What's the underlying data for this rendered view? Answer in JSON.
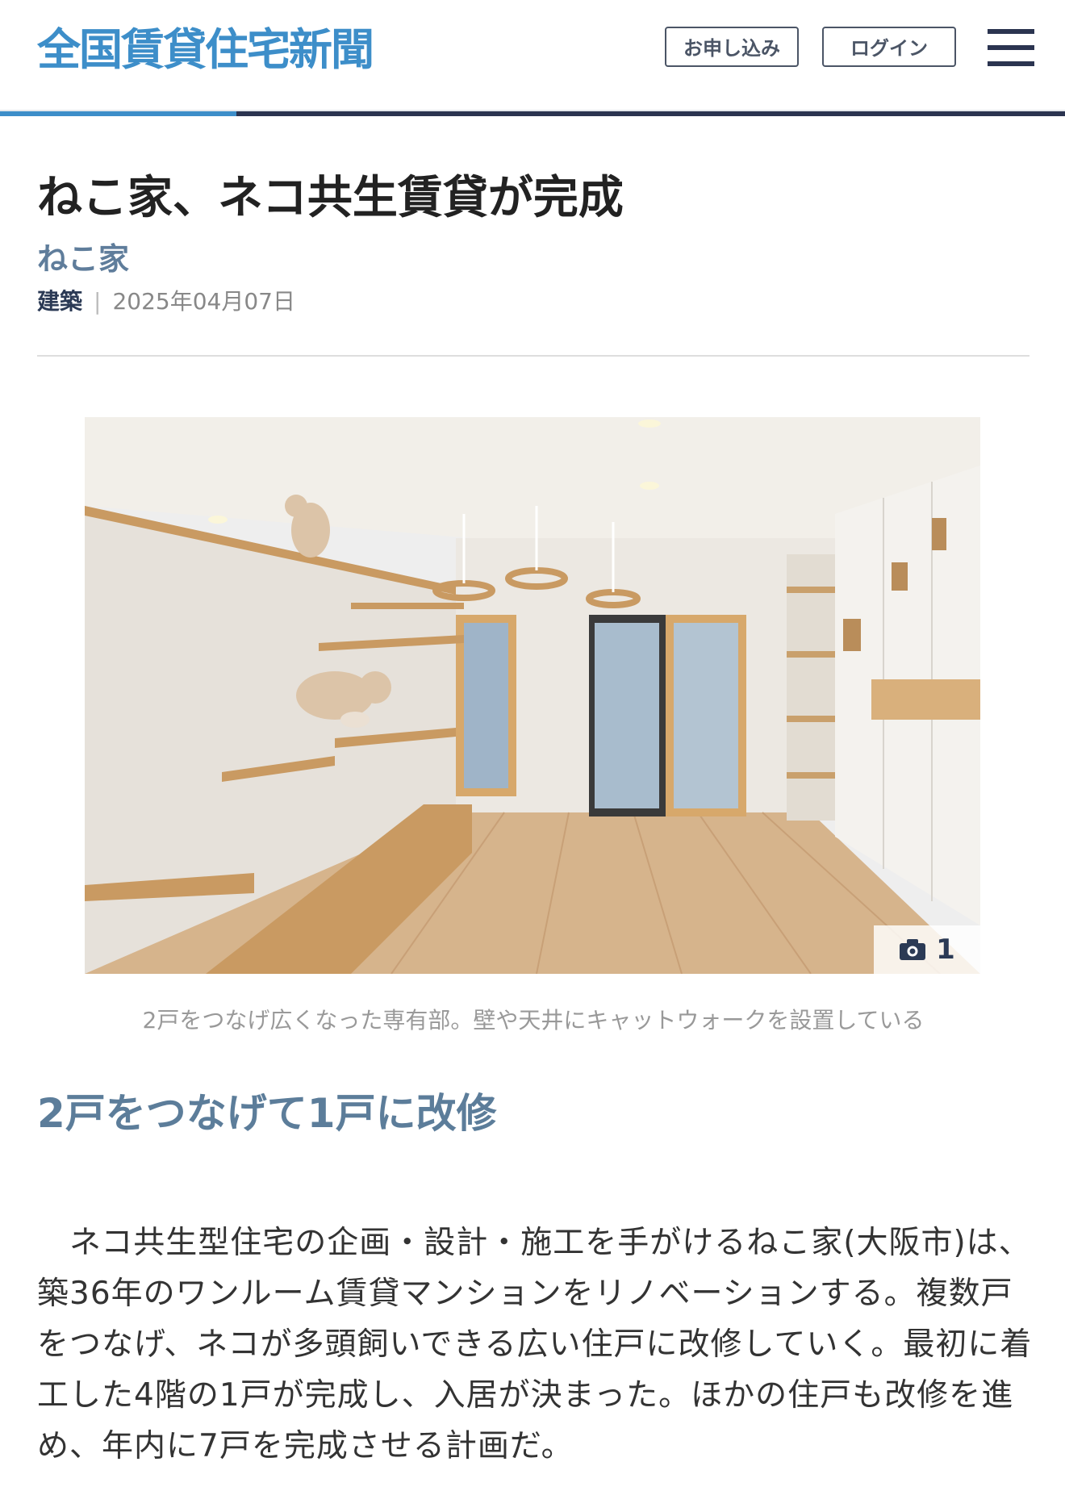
{
  "header": {
    "logo": "全国賃貸住宅新聞",
    "apply_label": "お申し込み",
    "login_label": "ログイン",
    "menu_icon": "hamburger-menu-icon"
  },
  "article": {
    "title": "ねこ家、ネコ共生賃貸が完成",
    "byline": "ねこ家",
    "category": "建築",
    "separator": "|",
    "date": "2025年04月07日",
    "photo": {
      "count": "1",
      "count_icon": "camera-icon",
      "caption": "2戸をつなげ広くなった専有部。壁や天井にキャットウォークを設置している"
    },
    "subheading": "2戸をつなげて1戸に改修",
    "paragraph": "ネコ共生型住宅の企画・設計・施工を手がけるねこ家(大阪市)は、築36年のワンルーム賃貸マンションをリノベーションする。複数戸をつなげ、ネコが多頭飼いできる広い住戸に改修していく。最初に着工した4階の1戸が完成し、入居が決まった。ほかの住戸も改修を進め、年内に7戸を完成させる計画だ。"
  },
  "colors": {
    "brand": "#3d8ec9",
    "navy": "#2b3450",
    "subheading": "#5c7d9a"
  }
}
